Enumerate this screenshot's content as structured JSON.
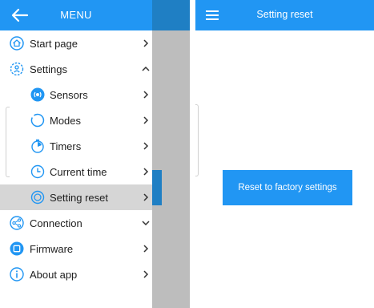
{
  "drawer": {
    "title": "MENU",
    "items": [
      {
        "label": "Start page"
      },
      {
        "label": "Settings"
      },
      {
        "label": "Sensors"
      },
      {
        "label": "Modes"
      },
      {
        "label": "Timers"
      },
      {
        "label": "Current time"
      },
      {
        "label": "Setting reset"
      },
      {
        "label": "Connection"
      },
      {
        "label": "Firmware"
      },
      {
        "label": "About app"
      }
    ]
  },
  "screen": {
    "title": "Setting reset",
    "reset_button_label": "Reset to factory settings"
  },
  "colors": {
    "accent": "#2196f3",
    "selected_item_bg": "#d6d6d6",
    "scrim": "#bdbdbd"
  }
}
